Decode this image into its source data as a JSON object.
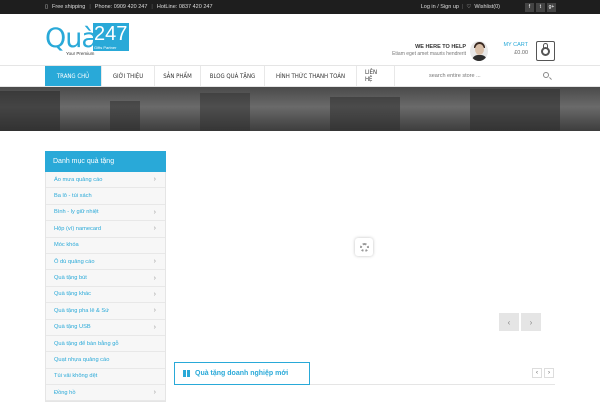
{
  "topbar": {
    "free_shipping": "Free shipping",
    "phone": "Phone: 0909 420 247",
    "hotline": "HotLine: 0837 420 247",
    "login": "Log in / Sign up",
    "wishlist": "Wishlist(0)",
    "social": [
      "f",
      "t",
      "g+"
    ]
  },
  "logo": {
    "text": "Quà",
    "number": "247",
    "tagline_left": "Your Premium",
    "tagline_right": "Gifts Partner"
  },
  "help": {
    "title": "WE HERE TO HELP",
    "subtitle": "Etiam eget amet mauris hendrerit"
  },
  "cart": {
    "label": "MY CART",
    "total": "£0.00"
  },
  "nav": {
    "items": [
      {
        "label": "TRANG CHỦ",
        "active": true
      },
      {
        "label": "GIỚI THIỆU"
      },
      {
        "label": "SẢN PHẨM"
      },
      {
        "label": "BLOG QUÀ TẶNG"
      },
      {
        "label": "HÌNH THỨC THANH TOÁN"
      },
      {
        "label": "LIÊN HỆ"
      }
    ],
    "search_placeholder": "search entire store ..."
  },
  "sidebar": {
    "title": "Danh mục quà tặng",
    "items": [
      {
        "label": "Áo mưa quảng cáo",
        "has_children": true
      },
      {
        "label": "Ba lô - túi xách",
        "has_children": false
      },
      {
        "label": "Bình - ly giữ nhiệt",
        "has_children": true
      },
      {
        "label": "Hộp (ví) namecard",
        "has_children": true
      },
      {
        "label": "Móc khóa",
        "has_children": false
      },
      {
        "label": "Ô dù quảng cáo",
        "has_children": true
      },
      {
        "label": "Quà tặng bút",
        "has_children": true
      },
      {
        "label": "Quà tặng khác",
        "has_children": true
      },
      {
        "label": "Quà tặng pha lê & Sứ",
        "has_children": true
      },
      {
        "label": "Quà tặng USB",
        "has_children": true
      },
      {
        "label": "Quà tặng để bàn bằng gỗ",
        "has_children": false
      },
      {
        "label": "Quạt nhựa quảng cáo",
        "has_children": false
      },
      {
        "label": "Túi vải không dệt",
        "has_children": false
      },
      {
        "label": "Đồng hồ",
        "has_children": true
      }
    ]
  },
  "slider": {
    "prev": "‹",
    "next": "›"
  },
  "section": {
    "title": "Quà tặng doanh nghiệp mới",
    "prev": "‹",
    "next": "›"
  },
  "colors": {
    "accent": "#29a9d8",
    "topbar": "#1e1e1e"
  }
}
